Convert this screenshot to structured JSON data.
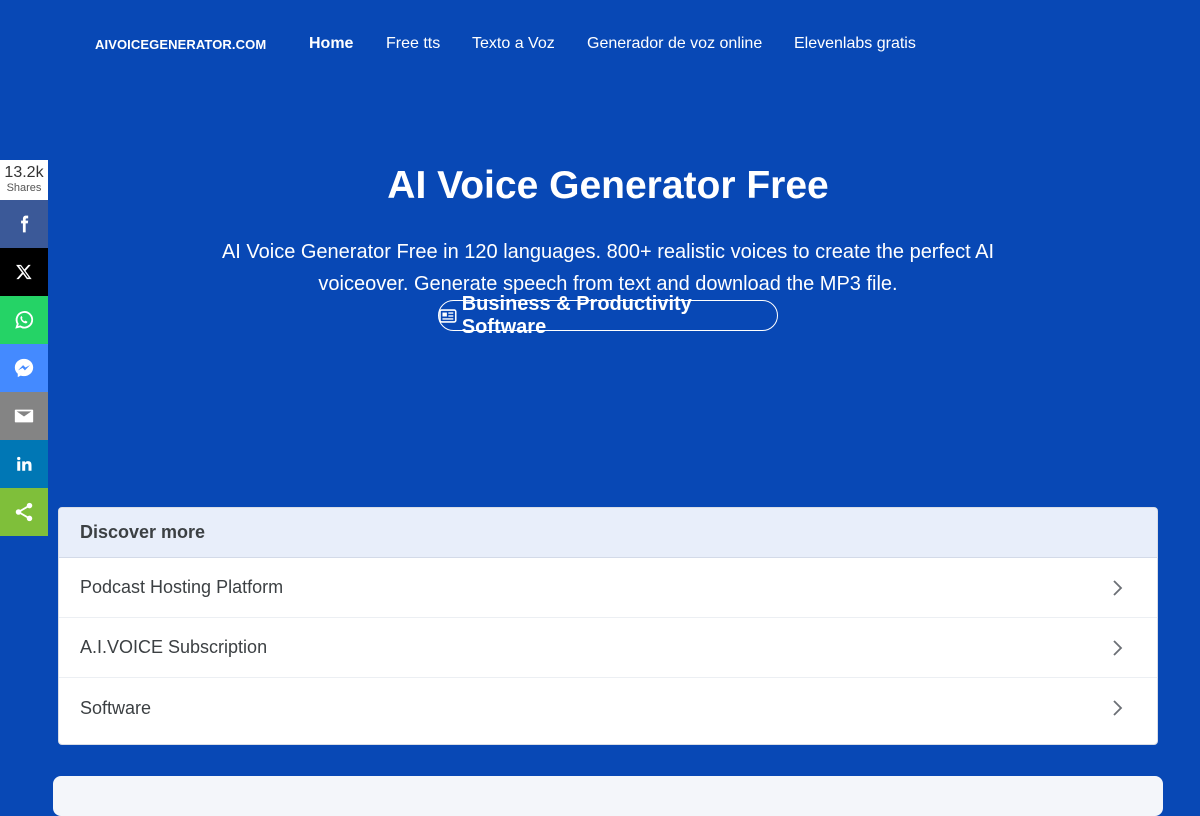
{
  "header": {
    "brand": "AIVOICEGENERATOR.COM",
    "nav": [
      {
        "label": "Home",
        "active": true
      },
      {
        "label": "Free tts"
      },
      {
        "label": "Texto a Voz"
      },
      {
        "label": "Generador de voz online"
      },
      {
        "label": "Elevenlabs gratis"
      }
    ]
  },
  "share": {
    "count": "13.2k",
    "count_label": "Shares",
    "buttons": [
      {
        "icon": "facebook-icon",
        "color": "#3b5998"
      },
      {
        "icon": "x-twitter-icon",
        "color": "#000000"
      },
      {
        "icon": "whatsapp-icon",
        "color": "#25d366"
      },
      {
        "icon": "messenger-icon",
        "color": "#448aff"
      },
      {
        "icon": "email-icon",
        "color": "#848484"
      },
      {
        "icon": "linkedin-icon",
        "color": "#0077b5"
      },
      {
        "icon": "share-icon",
        "color": "#7fbf3a"
      }
    ]
  },
  "hero": {
    "title": "AI Voice Generator Free",
    "description": "AI Voice Generator Free in 120 languages. 800+ realistic voices to create the perfect AI voiceover. Generate speech from text and download the MP3 file.",
    "category": {
      "icon": "newspaper-icon",
      "label": "Business & Productivity Software"
    }
  },
  "discover": {
    "title": "Discover more",
    "items": [
      {
        "label": "Podcast Hosting Platform"
      },
      {
        "label": "A.I.VOICE Subscription"
      },
      {
        "label": "Software"
      }
    ]
  },
  "colors": {
    "background": "#0848b5",
    "text": "#ffffff",
    "discover_header_bg": "#e8eefa"
  }
}
